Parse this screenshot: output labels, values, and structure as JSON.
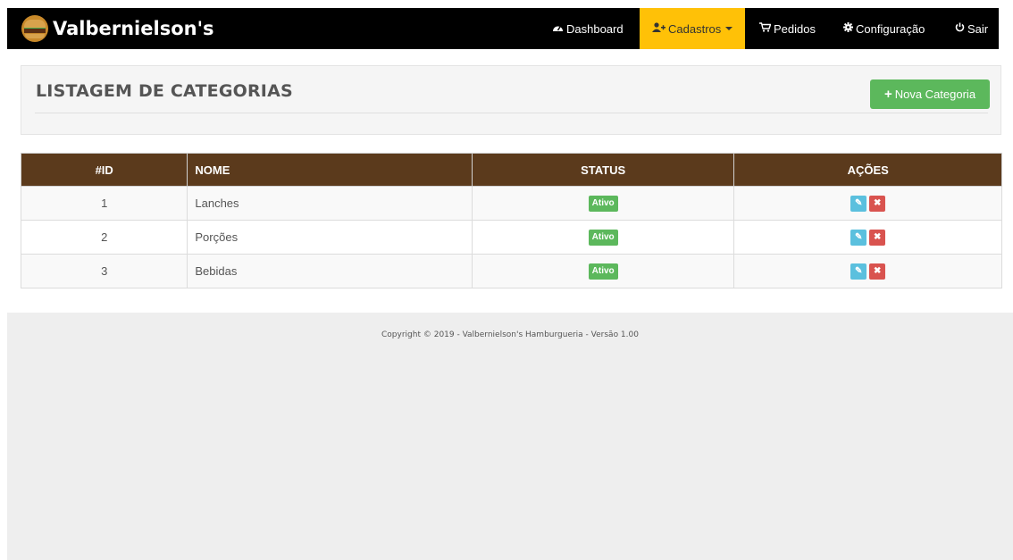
{
  "brand": {
    "name": "Valbernielson's",
    "logo_icon": "burger-logo-icon"
  },
  "nav": {
    "dashboard": {
      "label": "Dashboard",
      "icon": "dashboard-icon"
    },
    "cadastros": {
      "label": "Cadastros",
      "icon": "user-plus-icon",
      "active_color": "#ffc107"
    },
    "pedidos": {
      "label": "Pedidos",
      "icon": "cart-icon"
    },
    "configuracao": {
      "label": "Configuração",
      "icon": "gear-icon"
    },
    "sair": {
      "label": "Sair",
      "icon": "power-icon"
    }
  },
  "panel": {
    "title": "LISTAGEM DE CATEGORIAS",
    "new_button": "Nova Categoria"
  },
  "table": {
    "columns": [
      "#ID",
      "NOME",
      "STATUS",
      "AÇÕES"
    ],
    "rows": [
      {
        "id": "1",
        "nome": "Lanches",
        "status": "Ativo"
      },
      {
        "id": "2",
        "nome": "Porções",
        "status": "Ativo"
      },
      {
        "id": "3",
        "nome": "Bebidas",
        "status": "Ativo"
      }
    ],
    "header_color": "#5b3a1c",
    "status_color": "#5cb85c",
    "edit_color": "#5bc0de",
    "delete_color": "#d9534f"
  },
  "footer": {
    "text": "Copyright © 2019 - Valbernielson's Hamburgueria - Versão 1.00"
  }
}
